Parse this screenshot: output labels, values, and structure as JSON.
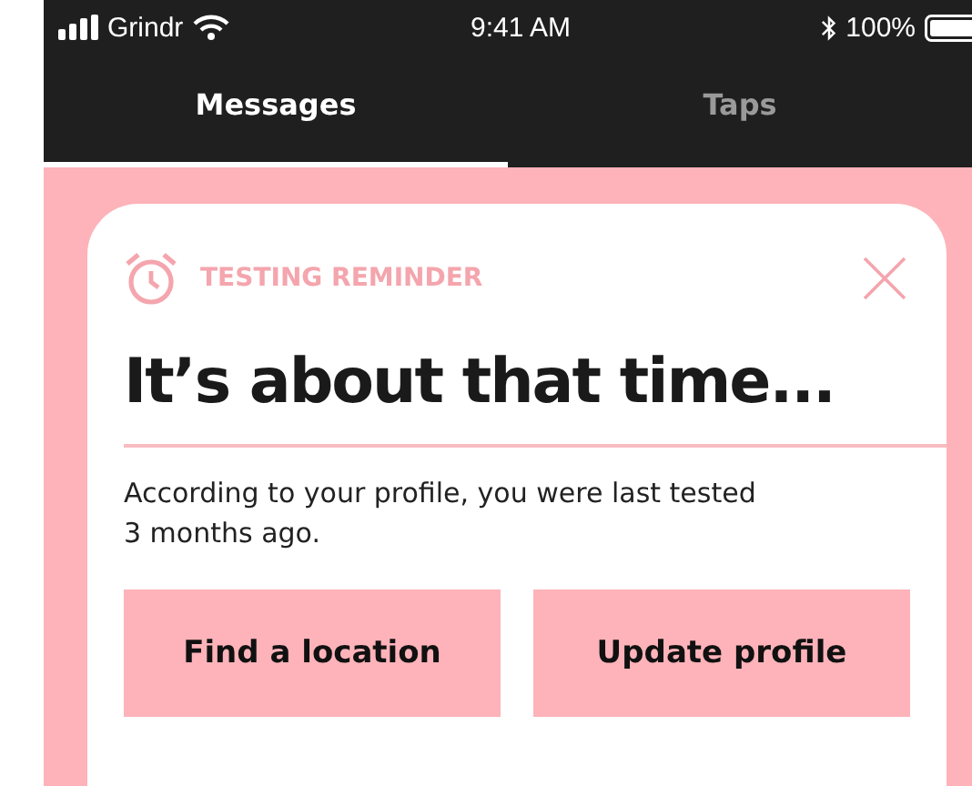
{
  "status_bar": {
    "carrier": "Grindr",
    "time": "9:41 AM",
    "battery": "100%"
  },
  "tabs": [
    {
      "label": "Messages",
      "selected": true
    },
    {
      "label": "Taps",
      "selected": false
    }
  ],
  "card": {
    "label": "TESTING REMINDER",
    "heading": "It’s about that time...",
    "body": "According to your profile, you were last tested 3 months ago.",
    "buttons": [
      {
        "label": "Find a location"
      },
      {
        "label": "Update profile"
      }
    ]
  }
}
